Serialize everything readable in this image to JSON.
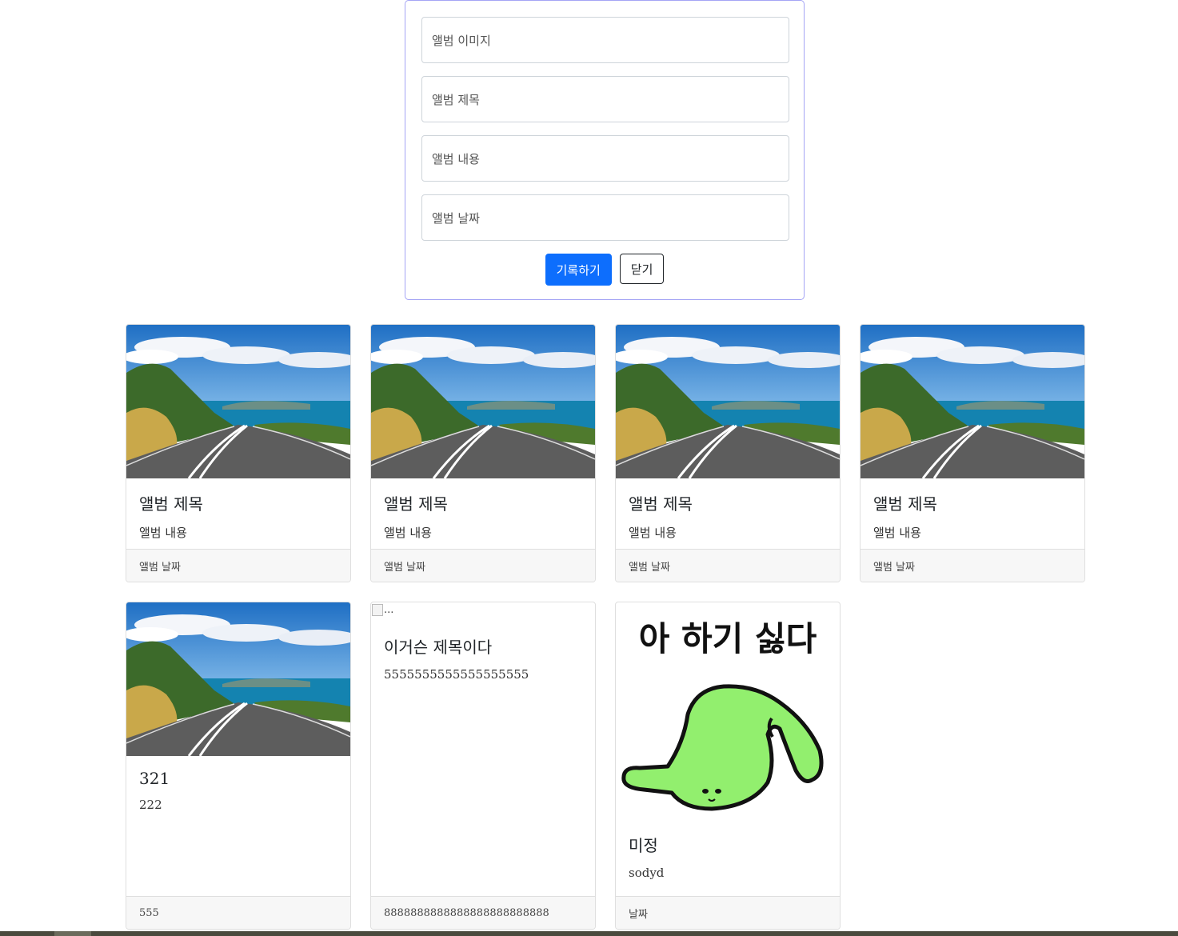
{
  "form": {
    "fields": [
      {
        "placeholder": "앨범 이미지"
      },
      {
        "placeholder": "앨범 제목"
      },
      {
        "placeholder": "앨범 내용"
      },
      {
        "placeholder": "앨범 날짜"
      }
    ],
    "submit_label": "기록하기",
    "close_label": "닫기"
  },
  "cards": [
    {
      "title": "앨범 제목",
      "text": "앨범 내용",
      "footer": "앨범 날짜",
      "image": "road-photo"
    },
    {
      "title": "앨범 제목",
      "text": "앨범 내용",
      "footer": "앨범 날짜",
      "image": "road-photo"
    },
    {
      "title": "앨범 제목",
      "text": "앨범 내용",
      "footer": "앨범 날짜",
      "image": "road-photo"
    },
    {
      "title": "앨범 제목",
      "text": "앨범 내용",
      "footer": "앨범 날짜",
      "image": "road-photo"
    },
    {
      "title": "321",
      "text": "222",
      "footer": "555",
      "image": "road-photo"
    },
    {
      "title": "이거슨 제목이다",
      "text": "5555555555555555555",
      "footer": "8888888888888888888888888",
      "image": "broken-image",
      "image_alt": "..."
    },
    {
      "title": "미정",
      "text": "sodyd",
      "footer": "날짜",
      "image": "green-creature-drawing",
      "image_caption": "아 하기 싫다"
    }
  ],
  "colors": {
    "primary": "#0d6efd",
    "form_border": "#a5a5f5",
    "footer_bg": "#f7f7f7"
  }
}
